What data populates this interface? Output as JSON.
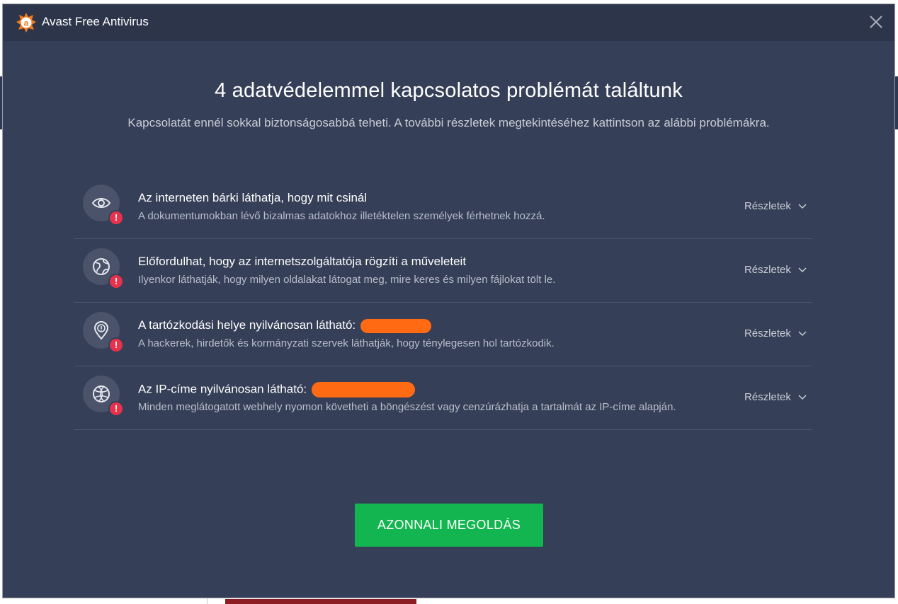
{
  "window": {
    "title": "Avast Free Antivirus",
    "logo_icon": "avast-logo-icon",
    "close_icon": "close-icon"
  },
  "main": {
    "headline": "4 adatvédelemmel kapcsolatos problémát találtunk",
    "subline": "Kapcsolatát ennél sokkal biztonságosabbá teheti. A további részletek megtekintéséhez kattintson az alábbi problémákra."
  },
  "issues": [
    {
      "icon": "eye-icon",
      "title": "Az interneten bárki láthatja, hogy mit csinál",
      "description": "A dokumentumokban lévő bizalmas adatokhoz illetéktelen személyek férhetnek hozzá.",
      "details_label": "Részletek",
      "redacted": false
    },
    {
      "icon": "globe-icon",
      "title": "Előfordulhat, hogy az internetszolgáltatója rögzíti a műveleteit",
      "description": "Ilyenkor láthatják, hogy milyen oldalakat látogat meg, mire keres és milyen fájlokat tölt le.",
      "details_label": "Részletek",
      "redacted": false
    },
    {
      "icon": "location-pin-icon",
      "title": "A tartózkodási helye nyilvánosan látható:",
      "description": "A hackerek, hirdetők és kormányzati szervek láthatják, hogy ténylegesen hol tartózkodik.",
      "details_label": "Részletek",
      "redacted": true
    },
    {
      "icon": "globe-network-icon",
      "title": "Az IP-címe nyilvánosan látható:",
      "description": "Minden meglátogatott webhely nyomon követheti a böngészést vagy cenzúrázhatja a tartalmát az IP-címe alapján.",
      "details_label": "Részletek",
      "redacted": true
    }
  ],
  "alert_badge": "!",
  "action": {
    "fix_label": "AZONNALI MEGOLDÁS"
  },
  "colors": {
    "background": "#353f57",
    "titlebar": "#2c354a",
    "accent_green": "#12b54f",
    "alert_red": "#e8314b",
    "redaction_orange": "#ff6a13",
    "logo_orange": "#f47a20"
  }
}
